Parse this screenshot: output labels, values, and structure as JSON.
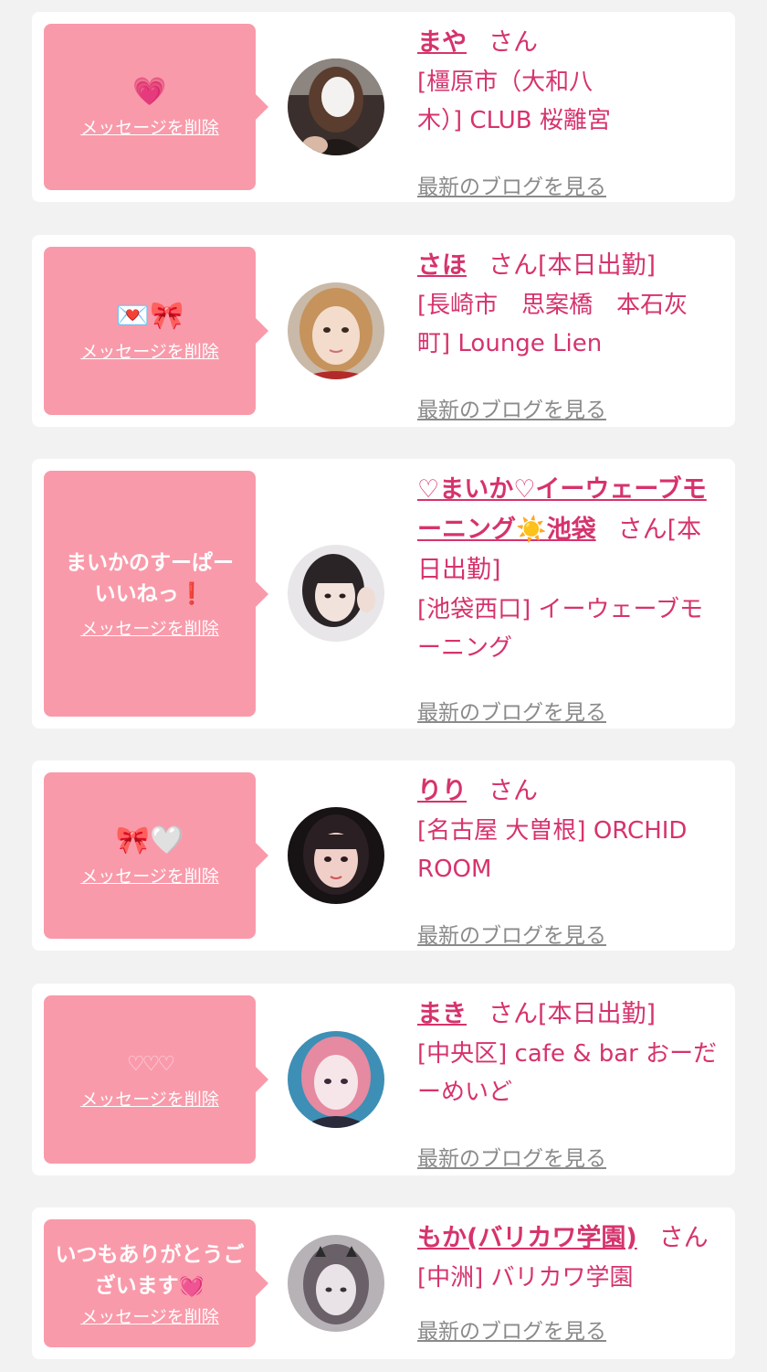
{
  "colors": {
    "accent": "#d6336c",
    "bubble": "#f99aaa",
    "link_gray": "#8a8a8a"
  },
  "labels": {
    "delete": "メッセージを削除",
    "san": "さん",
    "blog": "最新のブログを見る"
  },
  "messages": [
    {
      "message": "💗",
      "name": "まや",
      "status": "",
      "shop": [
        "[橿原市（大和八",
        "木）] CLUB 桜離宮"
      ]
    },
    {
      "message": "💌🎀",
      "name": "さほ",
      "status": "[本日出勤]",
      "shop": [
        "[長崎市　思案橋　本石灰",
        "町] Lounge Lien"
      ]
    },
    {
      "message": "まいかのすーぱーいいねっ❗️",
      "name": "♡まいか♡イーウェーブモーニング☀️池袋",
      "status": "[本日出勤]",
      "shop": [
        "[池袋西口] イーウェーブモ",
        "ーニング"
      ]
    },
    {
      "message": "🎀🤍",
      "name": "りり",
      "status": "",
      "shop": [
        "[名古屋 大曽根] ORCHID",
        "ROOM"
      ]
    },
    {
      "message": "♡♡♡",
      "name": "まき",
      "status": "[本日出勤]",
      "shop": [
        "[中央区] cafe & bar おーだ",
        "ーめいど"
      ]
    },
    {
      "message": "いつもありがとうございます💓",
      "name": "もか(バリカワ学園)",
      "status": "",
      "shop": [
        "[中洲] バリカワ学園"
      ]
    }
  ]
}
